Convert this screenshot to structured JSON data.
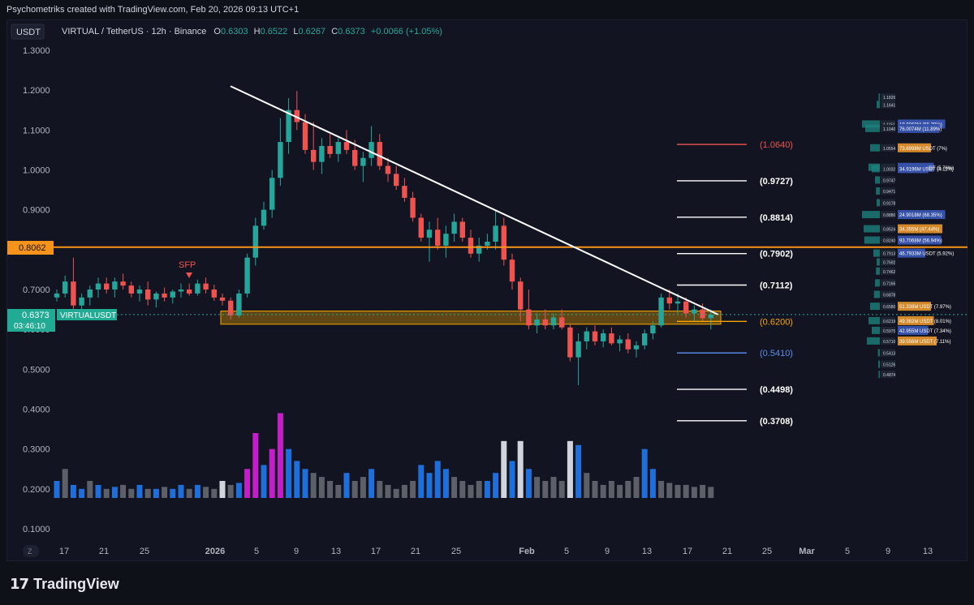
{
  "header": {
    "attribution": "Psychometriks created with TradingView.com, Feb 20, 2026 09:13 UTC+1"
  },
  "legend": {
    "currency_badge": "USDT",
    "symbol_text": "VIRTUAL / TetherUS · 12h · Binance",
    "o_label": "O",
    "o_value": "0.6303",
    "h_label": "H",
    "h_value": "0.6522",
    "l_label": "L",
    "l_value": "0.6267",
    "c_label": "C",
    "c_value": "0.6373",
    "change": "+0.0066 (+1.05%)"
  },
  "markers": {
    "sfp_label": "SFP",
    "current_price": "0.6373",
    "current_symbol": "VIRTUALUSDT",
    "countdown": "03:46:10",
    "resistance_price": "0.8062"
  },
  "footer": {
    "brand": "TradingView",
    "axis_mode": "Z"
  },
  "colors": {
    "background": "#121521",
    "up_candle": "#26a69a",
    "down_candle": "#ef5350",
    "resistance": "#f7931a",
    "zone": "#f7a600",
    "trendline": "#ffffff",
    "fib_red": "#ef5350",
    "fib_white": "#ffffff",
    "fib_orange": "#f7a600",
    "fib_blue": "#5b8def",
    "vol_blue": "#1e6fd9",
    "vol_grey": "#5d6068",
    "vol_white": "#d1d4dc",
    "vol_magenta": "#c31fc9"
  },
  "chart_data": {
    "type": "candlestick",
    "title": "VIRTUAL / TetherUS · 12h · Binance",
    "ylim": [
      0.08,
      1.32
    ],
    "y_ticks": [
      "1.3000",
      "1.2000",
      "1.1000",
      "1.0000",
      "0.9000",
      "0.8000",
      "0.7000",
      "0.6000",
      "0.5000",
      "0.4000",
      "0.3000",
      "0.2000",
      "0.1000"
    ],
    "x_ticks": [
      "17",
      "21",
      "25",
      "2026",
      "5",
      "9",
      "13",
      "17",
      "21",
      "25",
      "Feb",
      "5",
      "9",
      "13",
      "17",
      "21",
      "25",
      "Mar",
      "5",
      "9",
      "13"
    ],
    "resistance_level": 0.8062,
    "zone": [
      0.613,
      0.646
    ],
    "trendline": {
      "from": [
        "2026-01-03",
        1.21
      ],
      "to": [
        "2026-02-19",
        0.637
      ]
    },
    "fib_levels": [
      "(1.0640)",
      "(0.9727)",
      "(0.8814)",
      "(0.7902)",
      "(0.7112)",
      "(0.6200)",
      "(0.5410)",
      "(0.4498)",
      "(0.3708)"
    ],
    "fib_values": [
      1.064,
      0.9727,
      0.8814,
      0.7902,
      0.7112,
      0.62,
      0.541,
      0.4498,
      0.3708
    ],
    "fib_colors": [
      "#ef5350",
      "#ffffff",
      "#ffffff",
      "#ffffff",
      "#ffffff",
      "#f7a600",
      "#5b8def",
      "#ffffff",
      "#ffffff"
    ],
    "candles": [
      {
        "o": 0.68,
        "h": 0.7,
        "l": 0.67,
        "c": 0.69
      },
      {
        "o": 0.69,
        "h": 0.735,
        "l": 0.68,
        "c": 0.72
      },
      {
        "o": 0.72,
        "h": 0.78,
        "l": 0.64,
        "c": 0.66
      },
      {
        "o": 0.66,
        "h": 0.69,
        "l": 0.64,
        "c": 0.68
      },
      {
        "o": 0.68,
        "h": 0.71,
        "l": 0.66,
        "c": 0.7
      },
      {
        "o": 0.7,
        "h": 0.73,
        "l": 0.68,
        "c": 0.715
      },
      {
        "o": 0.715,
        "h": 0.73,
        "l": 0.69,
        "c": 0.7
      },
      {
        "o": 0.7,
        "h": 0.73,
        "l": 0.68,
        "c": 0.72
      },
      {
        "o": 0.72,
        "h": 0.74,
        "l": 0.7,
        "c": 0.71
      },
      {
        "o": 0.71,
        "h": 0.72,
        "l": 0.68,
        "c": 0.69
      },
      {
        "o": 0.69,
        "h": 0.71,
        "l": 0.67,
        "c": 0.7
      },
      {
        "o": 0.7,
        "h": 0.72,
        "l": 0.66,
        "c": 0.675
      },
      {
        "o": 0.675,
        "h": 0.695,
        "l": 0.655,
        "c": 0.69
      },
      {
        "o": 0.69,
        "h": 0.705,
        "l": 0.67,
        "c": 0.68
      },
      {
        "o": 0.68,
        "h": 0.7,
        "l": 0.665,
        "c": 0.695
      },
      {
        "o": 0.695,
        "h": 0.715,
        "l": 0.68,
        "c": 0.7
      },
      {
        "o": 0.7,
        "h": 0.715,
        "l": 0.685,
        "c": 0.69
      },
      {
        "o": 0.69,
        "h": 0.725,
        "l": 0.685,
        "c": 0.715
      },
      {
        "o": 0.715,
        "h": 0.73,
        "l": 0.69,
        "c": 0.7
      },
      {
        "o": 0.7,
        "h": 0.712,
        "l": 0.672,
        "c": 0.68
      },
      {
        "o": 0.68,
        "h": 0.69,
        "l": 0.66,
        "c": 0.672
      },
      {
        "o": 0.672,
        "h": 0.68,
        "l": 0.625,
        "c": 0.635
      },
      {
        "o": 0.635,
        "h": 0.7,
        "l": 0.63,
        "c": 0.69
      },
      {
        "o": 0.69,
        "h": 0.79,
        "l": 0.68,
        "c": 0.78
      },
      {
        "o": 0.78,
        "h": 0.88,
        "l": 0.76,
        "c": 0.86
      },
      {
        "o": 0.86,
        "h": 0.92,
        "l": 0.85,
        "c": 0.9
      },
      {
        "o": 0.9,
        "h": 1.0,
        "l": 0.88,
        "c": 0.98
      },
      {
        "o": 0.98,
        "h": 1.13,
        "l": 0.96,
        "c": 1.07
      },
      {
        "o": 1.07,
        "h": 1.18,
        "l": 1.04,
        "c": 1.15
      },
      {
        "o": 1.15,
        "h": 1.198,
        "l": 1.1,
        "c": 1.12
      },
      {
        "o": 1.12,
        "h": 1.14,
        "l": 1.04,
        "c": 1.05
      },
      {
        "o": 1.05,
        "h": 1.12,
        "l": 1.0,
        "c": 1.02
      },
      {
        "o": 1.02,
        "h": 1.08,
        "l": 0.99,
        "c": 1.06
      },
      {
        "o": 1.06,
        "h": 1.09,
        "l": 1.03,
        "c": 1.04
      },
      {
        "o": 1.04,
        "h": 1.08,
        "l": 1.02,
        "c": 1.07
      },
      {
        "o": 1.07,
        "h": 1.1,
        "l": 1.04,
        "c": 1.05
      },
      {
        "o": 1.05,
        "h": 1.075,
        "l": 1.0,
        "c": 1.01
      },
      {
        "o": 1.01,
        "h": 1.045,
        "l": 0.97,
        "c": 1.03
      },
      {
        "o": 1.03,
        "h": 1.11,
        "l": 1.01,
        "c": 1.07
      },
      {
        "o": 1.07,
        "h": 1.09,
        "l": 1.0,
        "c": 1.01
      },
      {
        "o": 1.01,
        "h": 1.03,
        "l": 0.97,
        "c": 0.99
      },
      {
        "o": 0.99,
        "h": 1.01,
        "l": 0.95,
        "c": 0.96
      },
      {
        "o": 0.96,
        "h": 0.98,
        "l": 0.92,
        "c": 0.93
      },
      {
        "o": 0.93,
        "h": 0.945,
        "l": 0.87,
        "c": 0.88
      },
      {
        "o": 0.88,
        "h": 0.89,
        "l": 0.82,
        "c": 0.83
      },
      {
        "o": 0.83,
        "h": 0.87,
        "l": 0.77,
        "c": 0.85
      },
      {
        "o": 0.85,
        "h": 0.88,
        "l": 0.8,
        "c": 0.81
      },
      {
        "o": 0.81,
        "h": 0.86,
        "l": 0.78,
        "c": 0.84
      },
      {
        "o": 0.84,
        "h": 0.89,
        "l": 0.82,
        "c": 0.87
      },
      {
        "o": 0.87,
        "h": 0.88,
        "l": 0.82,
        "c": 0.83
      },
      {
        "o": 0.83,
        "h": 0.85,
        "l": 0.78,
        "c": 0.79
      },
      {
        "o": 0.79,
        "h": 0.83,
        "l": 0.77,
        "c": 0.81
      },
      {
        "o": 0.81,
        "h": 0.84,
        "l": 0.8,
        "c": 0.82
      },
      {
        "o": 0.82,
        "h": 0.9,
        "l": 0.8,
        "c": 0.86
      },
      {
        "o": 0.86,
        "h": 0.88,
        "l": 0.76,
        "c": 0.775
      },
      {
        "o": 0.775,
        "h": 0.79,
        "l": 0.7,
        "c": 0.72
      },
      {
        "o": 0.72,
        "h": 0.73,
        "l": 0.62,
        "c": 0.65
      },
      {
        "o": 0.65,
        "h": 0.7,
        "l": 0.6,
        "c": 0.61
      },
      {
        "o": 0.61,
        "h": 0.64,
        "l": 0.59,
        "c": 0.625
      },
      {
        "o": 0.625,
        "h": 0.65,
        "l": 0.6,
        "c": 0.61
      },
      {
        "o": 0.61,
        "h": 0.64,
        "l": 0.6,
        "c": 0.63
      },
      {
        "o": 0.63,
        "h": 0.65,
        "l": 0.6,
        "c": 0.605
      },
      {
        "o": 0.605,
        "h": 0.615,
        "l": 0.52,
        "c": 0.53
      },
      {
        "o": 0.53,
        "h": 0.59,
        "l": 0.46,
        "c": 0.57
      },
      {
        "o": 0.57,
        "h": 0.605,
        "l": 0.55,
        "c": 0.595
      },
      {
        "o": 0.595,
        "h": 0.61,
        "l": 0.56,
        "c": 0.57
      },
      {
        "o": 0.57,
        "h": 0.6,
        "l": 0.555,
        "c": 0.59
      },
      {
        "o": 0.59,
        "h": 0.605,
        "l": 0.56,
        "c": 0.565
      },
      {
        "o": 0.565,
        "h": 0.585,
        "l": 0.545,
        "c": 0.575
      },
      {
        "o": 0.575,
        "h": 0.59,
        "l": 0.54,
        "c": 0.55
      },
      {
        "o": 0.55,
        "h": 0.57,
        "l": 0.53,
        "c": 0.56
      },
      {
        "o": 0.56,
        "h": 0.6,
        "l": 0.55,
        "c": 0.59
      },
      {
        "o": 0.59,
        "h": 0.62,
        "l": 0.575,
        "c": 0.61
      },
      {
        "o": 0.61,
        "h": 0.69,
        "l": 0.605,
        "c": 0.68
      },
      {
        "o": 0.68,
        "h": 0.7,
        "l": 0.65,
        "c": 0.665
      },
      {
        "o": 0.665,
        "h": 0.69,
        "l": 0.64,
        "c": 0.67
      },
      {
        "o": 0.67,
        "h": 0.68,
        "l": 0.63,
        "c": 0.64
      },
      {
        "o": 0.64,
        "h": 0.66,
        "l": 0.62,
        "c": 0.65
      },
      {
        "o": 0.65,
        "h": 0.665,
        "l": 0.62,
        "c": 0.628
      },
      {
        "o": 0.628,
        "h": 0.65,
        "l": 0.6,
        "c": 0.637
      }
    ],
    "volume": [
      {
        "v": 0.22,
        "c": "blue"
      },
      {
        "v": 0.25,
        "c": "grey"
      },
      {
        "v": 0.21,
        "c": "blue"
      },
      {
        "v": 0.2,
        "c": "blue"
      },
      {
        "v": 0.22,
        "c": "grey"
      },
      {
        "v": 0.21,
        "c": "blue"
      },
      {
        "v": 0.2,
        "c": "grey"
      },
      {
        "v": 0.205,
        "c": "blue"
      },
      {
        "v": 0.21,
        "c": "grey"
      },
      {
        "v": 0.2,
        "c": "grey"
      },
      {
        "v": 0.21,
        "c": "blue"
      },
      {
        "v": 0.2,
        "c": "grey"
      },
      {
        "v": 0.2,
        "c": "blue"
      },
      {
        "v": 0.205,
        "c": "grey"
      },
      {
        "v": 0.2,
        "c": "blue"
      },
      {
        "v": 0.21,
        "c": "blue"
      },
      {
        "v": 0.2,
        "c": "grey"
      },
      {
        "v": 0.21,
        "c": "blue"
      },
      {
        "v": 0.205,
        "c": "grey"
      },
      {
        "v": 0.2,
        "c": "grey"
      },
      {
        "v": 0.22,
        "c": "white"
      },
      {
        "v": 0.21,
        "c": "grey"
      },
      {
        "v": 0.215,
        "c": "blue"
      },
      {
        "v": 0.25,
        "c": "magenta"
      },
      {
        "v": 0.34,
        "c": "magenta"
      },
      {
        "v": 0.26,
        "c": "blue"
      },
      {
        "v": 0.3,
        "c": "magenta"
      },
      {
        "v": 0.39,
        "c": "magenta"
      },
      {
        "v": 0.3,
        "c": "blue"
      },
      {
        "v": 0.27,
        "c": "blue"
      },
      {
        "v": 0.25,
        "c": "blue"
      },
      {
        "v": 0.24,
        "c": "grey"
      },
      {
        "v": 0.23,
        "c": "grey"
      },
      {
        "v": 0.22,
        "c": "grey"
      },
      {
        "v": 0.21,
        "c": "grey"
      },
      {
        "v": 0.24,
        "c": "blue"
      },
      {
        "v": 0.22,
        "c": "grey"
      },
      {
        "v": 0.23,
        "c": "grey"
      },
      {
        "v": 0.25,
        "c": "blue"
      },
      {
        "v": 0.22,
        "c": "grey"
      },
      {
        "v": 0.21,
        "c": "grey"
      },
      {
        "v": 0.2,
        "c": "grey"
      },
      {
        "v": 0.21,
        "c": "grey"
      },
      {
        "v": 0.22,
        "c": "grey"
      },
      {
        "v": 0.26,
        "c": "blue"
      },
      {
        "v": 0.24,
        "c": "blue"
      },
      {
        "v": 0.27,
        "c": "blue"
      },
      {
        "v": 0.25,
        "c": "blue"
      },
      {
        "v": 0.23,
        "c": "grey"
      },
      {
        "v": 0.22,
        "c": "grey"
      },
      {
        "v": 0.21,
        "c": "grey"
      },
      {
        "v": 0.22,
        "c": "grey"
      },
      {
        "v": 0.22,
        "c": "blue"
      },
      {
        "v": 0.24,
        "c": "blue"
      },
      {
        "v": 0.32,
        "c": "white"
      },
      {
        "v": 0.27,
        "c": "blue"
      },
      {
        "v": 0.32,
        "c": "white"
      },
      {
        "v": 0.25,
        "c": "blue"
      },
      {
        "v": 0.23,
        "c": "grey"
      },
      {
        "v": 0.22,
        "c": "grey"
      },
      {
        "v": 0.23,
        "c": "grey"
      },
      {
        "v": 0.22,
        "c": "grey"
      },
      {
        "v": 0.32,
        "c": "white"
      },
      {
        "v": 0.31,
        "c": "blue"
      },
      {
        "v": 0.24,
        "c": "grey"
      },
      {
        "v": 0.22,
        "c": "grey"
      },
      {
        "v": 0.21,
        "c": "grey"
      },
      {
        "v": 0.22,
        "c": "grey"
      },
      {
        "v": 0.21,
        "c": "grey"
      },
      {
        "v": 0.22,
        "c": "grey"
      },
      {
        "v": 0.23,
        "c": "grey"
      },
      {
        "v": 0.3,
        "c": "blue"
      },
      {
        "v": 0.25,
        "c": "blue"
      },
      {
        "v": 0.22,
        "c": "grey"
      },
      {
        "v": 0.215,
        "c": "grey"
      },
      {
        "v": 0.21,
        "c": "grey"
      },
      {
        "v": 0.21,
        "c": "grey"
      },
      {
        "v": 0.205,
        "c": "grey"
      },
      {
        "v": 0.21,
        "c": "grey"
      },
      {
        "v": 0.205,
        "c": "grey"
      }
    ],
    "volume_profile": [
      {
        "price": "1.1826",
        "vol": "",
        "pct": 0.04,
        "strong": false
      },
      {
        "price": "1.1641",
        "vol": "",
        "pct": 0.1,
        "strong": false
      },
      {
        "price": "1.1151",
        "vol": "19.9060M (55.79%)",
        "pct": 0.55,
        "strong": false
      },
      {
        "price": "1.1040",
        "vol": "76.0074M (11.89%)",
        "pct": 0.45,
        "strong": false
      },
      {
        "price": "1.0554",
        "vol": "73.6998M USDT (7%)",
        "pct": 0.3,
        "strong": true
      },
      {
        "price": "1.0066",
        "vol": "58.9318M USDT (5.76%)",
        "pct": 0.35,
        "strong": false
      },
      {
        "price": "1.0032",
        "vol": "34.9196M USDT (4.11%)",
        "pct": 0.25,
        "strong": false
      },
      {
        "price": "0.9747",
        "vol": "",
        "pct": 0.15,
        "strong": false
      },
      {
        "price": "0.9471",
        "vol": "",
        "pct": 0.12,
        "strong": false
      },
      {
        "price": "0.9178",
        "vol": "",
        "pct": 0.1,
        "strong": false
      },
      {
        "price": "0.8880",
        "vol": "24.9018M (68.35%)",
        "pct": 0.55,
        "strong": false
      },
      {
        "price": "0.8524",
        "vol": "34.355M (47.44%)",
        "pct": 0.5,
        "strong": true
      },
      {
        "price": "0.8240",
        "vol": "93.7068M (56.94%)",
        "pct": 0.48,
        "strong": false
      },
      {
        "price": "0.7913",
        "vol": "46.7933M USDT (5.92%)",
        "pct": 0.2,
        "strong": false
      },
      {
        "price": "0.7692",
        "vol": "",
        "pct": 0.1,
        "strong": false
      },
      {
        "price": "0.7462",
        "vol": "",
        "pct": 0.12,
        "strong": false
      },
      {
        "price": "0.7166",
        "vol": "",
        "pct": 0.15,
        "strong": false
      },
      {
        "price": "0.6878",
        "vol": "",
        "pct": 0.18,
        "strong": false
      },
      {
        "price": "0.6580",
        "vol": "51.338M USDT (7.97%)",
        "pct": 0.3,
        "strong": true
      },
      {
        "price": "0.6219",
        "vol": "49.362M USDT (8.01%)",
        "pct": 0.35,
        "strong": true
      },
      {
        "price": "0.5975",
        "vol": "42.955M USDT (7.34%)",
        "pct": 0.25,
        "strong": false
      },
      {
        "price": "0.5710",
        "vol": "39.556M USDT (7.11%)",
        "pct": 0.4,
        "strong": true
      },
      {
        "price": "0.5413",
        "vol": "",
        "pct": 0.06,
        "strong": false
      },
      {
        "price": "0.5126",
        "vol": "",
        "pct": 0.05,
        "strong": false
      },
      {
        "price": "0.4874",
        "vol": "",
        "pct": 0.04,
        "strong": false
      }
    ]
  }
}
